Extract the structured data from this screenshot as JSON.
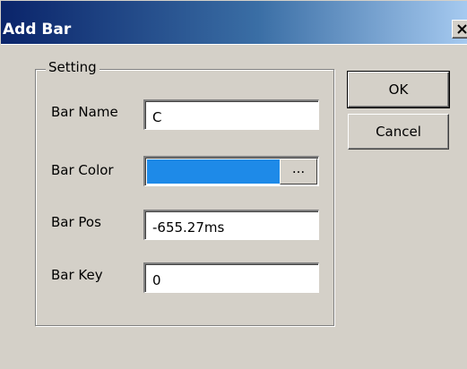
{
  "window": {
    "title": "Add Bar",
    "close_icon": "close-icon"
  },
  "group": {
    "title": "Setting"
  },
  "fields": {
    "bar_name": {
      "label": "Bar Name",
      "value": "C"
    },
    "bar_color": {
      "label": "Bar Color",
      "color": "#1e8ae8",
      "browse_label": "..."
    },
    "bar_pos": {
      "label": "Bar Pos",
      "value": "-655.27ms"
    },
    "bar_key": {
      "label": "Bar Key",
      "value": "0"
    }
  },
  "buttons": {
    "ok": "OK",
    "cancel": "Cancel"
  }
}
